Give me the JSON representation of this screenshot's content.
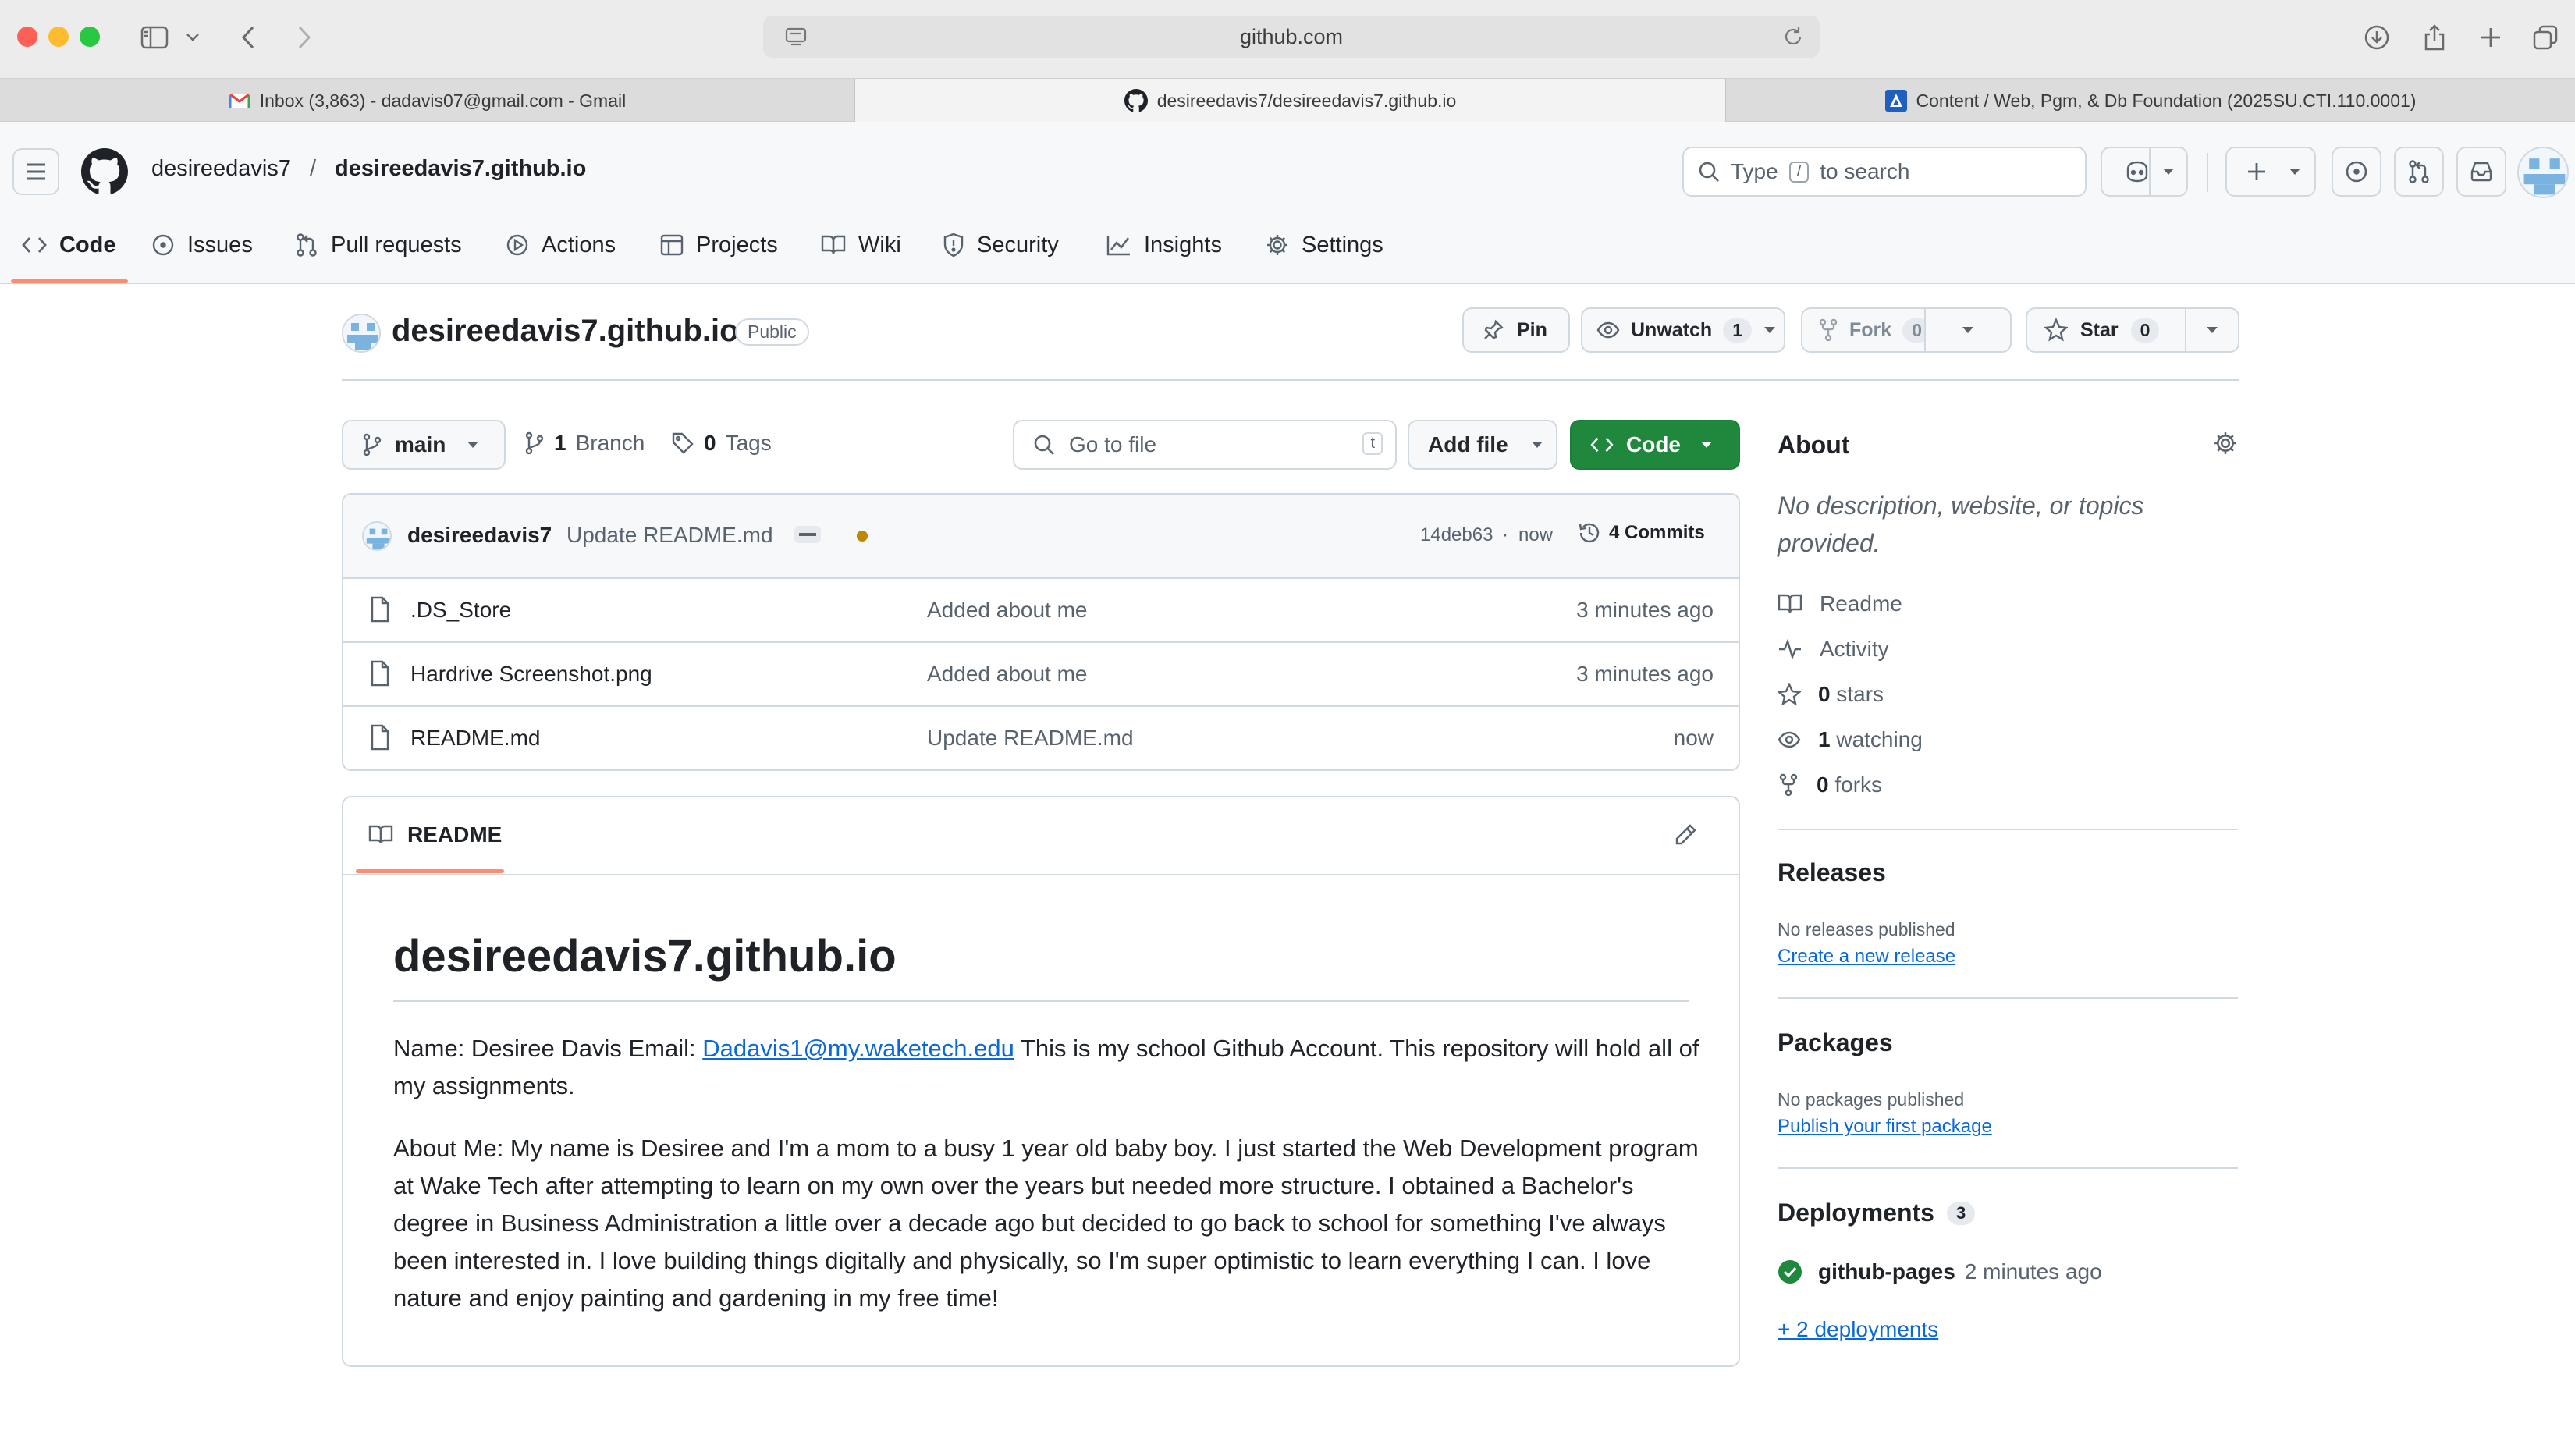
{
  "browser": {
    "url": "github.com",
    "tabs": [
      {
        "label": "Inbox (3,863) - dadavis07@gmail.com - Gmail",
        "icon": "gmail-icon"
      },
      {
        "label": "desireedavis7/desireedavis7.github.io",
        "icon": "github-icon"
      },
      {
        "label": "Content / Web, Pgm, & Db Foundation (2025SU.CTI.110.0001)",
        "icon": "brightspace-icon"
      }
    ]
  },
  "header": {
    "owner": "desireedavis7",
    "separator": "/",
    "repo": "desireedavis7.github.io",
    "search": {
      "prefix": "Type",
      "key": "/",
      "suffix": "to search"
    }
  },
  "nav": [
    {
      "label": "Code",
      "icon": "code-icon"
    },
    {
      "label": "Issues",
      "icon": "issue-icon"
    },
    {
      "label": "Pull requests",
      "icon": "pull-request-icon"
    },
    {
      "label": "Actions",
      "icon": "play-icon"
    },
    {
      "label": "Projects",
      "icon": "table-icon"
    },
    {
      "label": "Wiki",
      "icon": "book-icon"
    },
    {
      "label": "Security",
      "icon": "shield-icon"
    },
    {
      "label": "Insights",
      "icon": "graph-icon"
    },
    {
      "label": "Settings",
      "icon": "gear-icon"
    }
  ],
  "repo": {
    "title": "desireedavis7.github.io",
    "visibility": "Public",
    "pin": "Pin",
    "unwatch": "Unwatch",
    "watch_count": "1",
    "fork": "Fork",
    "fork_count": "0",
    "star": "Star",
    "star_count": "0"
  },
  "toolbar": {
    "branch": "main",
    "branch_count": "1",
    "branch_label": "Branch",
    "tag_count": "0",
    "tag_label": "Tags",
    "goto_placeholder": "Go to file",
    "goto_key": "t",
    "add_file": "Add file",
    "code": "Code"
  },
  "commit": {
    "author": "desireedavis7",
    "message": "Update README.md",
    "hash": "14deb63",
    "sep": "·",
    "time": "now",
    "count": "4 Commits"
  },
  "files": [
    {
      "name": ".DS_Store",
      "message": "Added about me",
      "age": "3 minutes ago"
    },
    {
      "name": "Hardrive Screenshot.png",
      "message": "Added about me",
      "age": "3 minutes ago"
    },
    {
      "name": "README.md",
      "message": "Update README.md",
      "age": "now"
    }
  ],
  "readme": {
    "tab": "README",
    "heading": "desireedavis7.github.io",
    "p1_before": "Name: Desiree Davis Email: ",
    "p1_link": "Dadavis1@my.waketech.edu",
    "p1_after": " This is my school Github Account. This repository will hold all of my assignments.",
    "p2": "About Me: My name is Desiree and I'm a mom to a busy 1 year old baby boy. I just started the Web Development program at Wake Tech after attempting to learn on my own over the years but needed more structure. I obtained a Bachelor's degree in Business Administration a little over a decade ago but decided to go back to school for something I've always been interested in. I love building things digitally and physically, so I'm super optimistic to learn everything I can. I love nature and enjoy painting and gardening in my free time!"
  },
  "about": {
    "title": "About",
    "description": "No description, website, or topics provided.",
    "readme": "Readme",
    "activity": "Activity",
    "stars_count": "0",
    "stars_label": "stars",
    "watching_count": "1",
    "watching_label": "watching",
    "forks_count": "0",
    "forks_label": "forks"
  },
  "releases": {
    "title": "Releases",
    "empty": "No releases published",
    "link": "Create a new release"
  },
  "packages": {
    "title": "Packages",
    "empty": "No packages published",
    "link": "Publish your first package"
  },
  "deployments": {
    "title": "Deployments",
    "count": "3",
    "name": "github-pages",
    "time": "2 minutes ago",
    "more": "+ 2 deployments"
  },
  "colors": {
    "accent_orange": "#fd8c73",
    "green": "#1f883d",
    "link": "#0969da",
    "muted": "#59636e"
  }
}
